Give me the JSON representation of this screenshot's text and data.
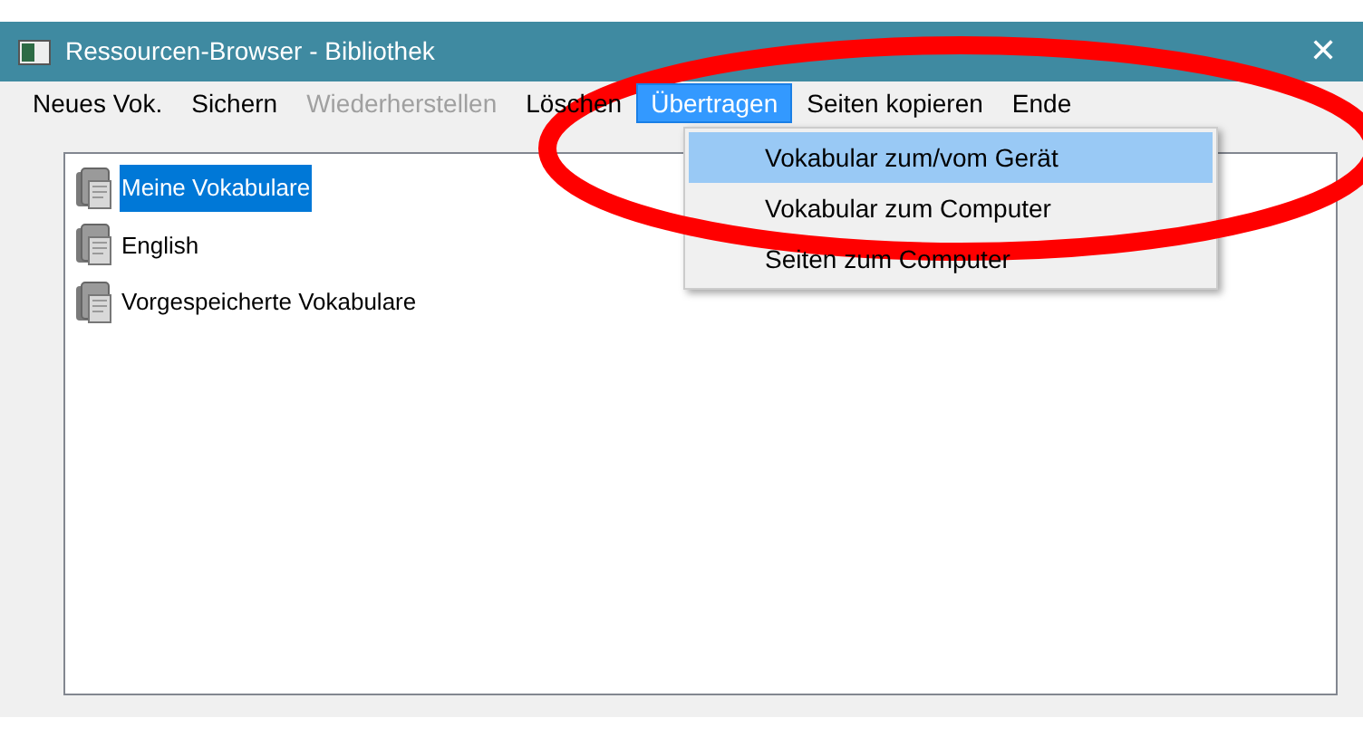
{
  "window": {
    "title": "Ressourcen-Browser - Bibliothek",
    "close": "✕"
  },
  "menu": [
    {
      "label": "Neues Vok.",
      "disabled": false,
      "selected": false
    },
    {
      "label": "Sichern",
      "disabled": false,
      "selected": false
    },
    {
      "label": "Wiederherstellen",
      "disabled": true,
      "selected": false
    },
    {
      "label": "Löschen",
      "disabled": false,
      "selected": false
    },
    {
      "label": "Übertragen",
      "disabled": false,
      "selected": true
    },
    {
      "label": "Seiten kopieren",
      "disabled": false,
      "selected": false
    },
    {
      "label": "Ende",
      "disabled": false,
      "selected": false
    }
  ],
  "dropdown": [
    {
      "label": "Vokabular zum/vom Gerät",
      "selected": true
    },
    {
      "label": "Vokabular zum Computer",
      "selected": false
    },
    {
      "label": "Seiten zum Computer",
      "selected": false
    }
  ],
  "library": [
    {
      "label": "Meine Vokabulare",
      "selected": true
    },
    {
      "label": "English",
      "selected": false
    },
    {
      "label": "Vorgespeicherte Vokabulare",
      "selected": false
    }
  ],
  "annotation": {
    "kind": "ellipse",
    "color": "#ff0000"
  }
}
